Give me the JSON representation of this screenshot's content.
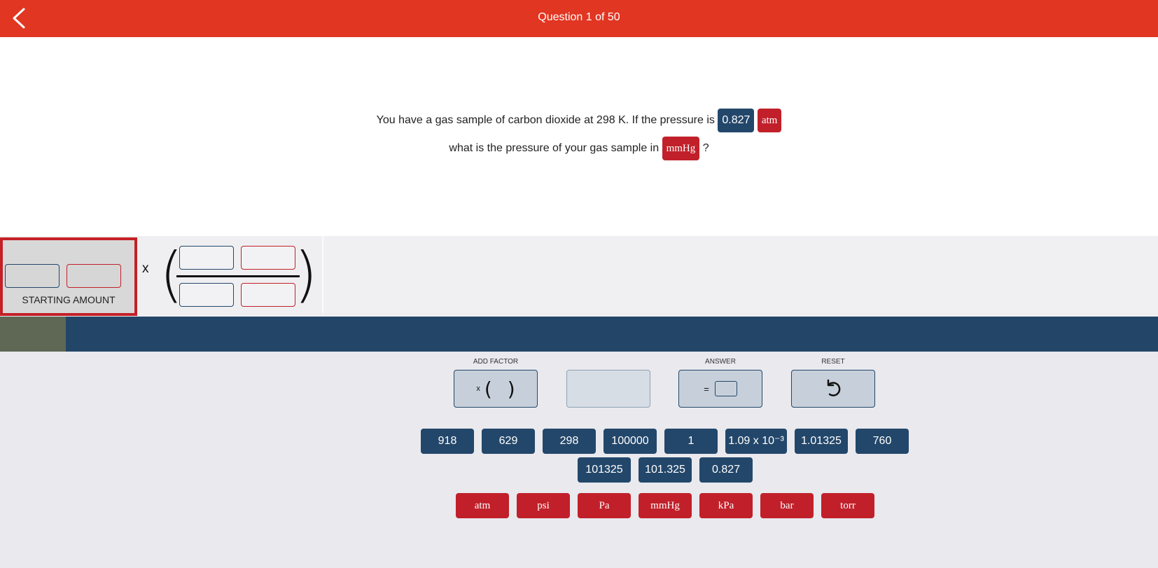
{
  "header": {
    "title": "Question 1 of 50",
    "back_icon": "chevron-left-icon"
  },
  "question": {
    "line1_text": "You have a gas sample of carbon dioxide at 298 K. If the pressure is",
    "given_value": "0.827",
    "given_unit": "atm",
    "line2_text": "what is the pressure of your gas sample in",
    "target_unit": "mmHg",
    "line2_end": "?"
  },
  "workspace": {
    "starting_amount_label": "STARTING AMOUNT",
    "times_symbol": "x",
    "open_paren": "(",
    "close_paren": ")"
  },
  "progress": {
    "fraction": 0.057
  },
  "controls": {
    "add_factor_label": "ADD FACTOR",
    "add_factor_x": "x",
    "add_factor_open": "(",
    "add_factor_close": ")",
    "answer_label": "ANSWER",
    "answer_symbol": "=",
    "reset_label": "RESET",
    "reset_icon": "undo-icon"
  },
  "number_tiles": [
    "918",
    "629",
    "298",
    "100000",
    "1",
    "1.09 x 10⁻³",
    "1.01325",
    "760",
    "101325",
    "101.325",
    "0.827"
  ],
  "unit_tiles": [
    "atm",
    "psi",
    "Pa",
    "mmHg",
    "kPa",
    "bar",
    "torr"
  ],
  "colors": {
    "header_red": "#e13622",
    "value_blue": "#23476a",
    "unit_red": "#c1202a",
    "progress_fill": "#5e6854"
  }
}
